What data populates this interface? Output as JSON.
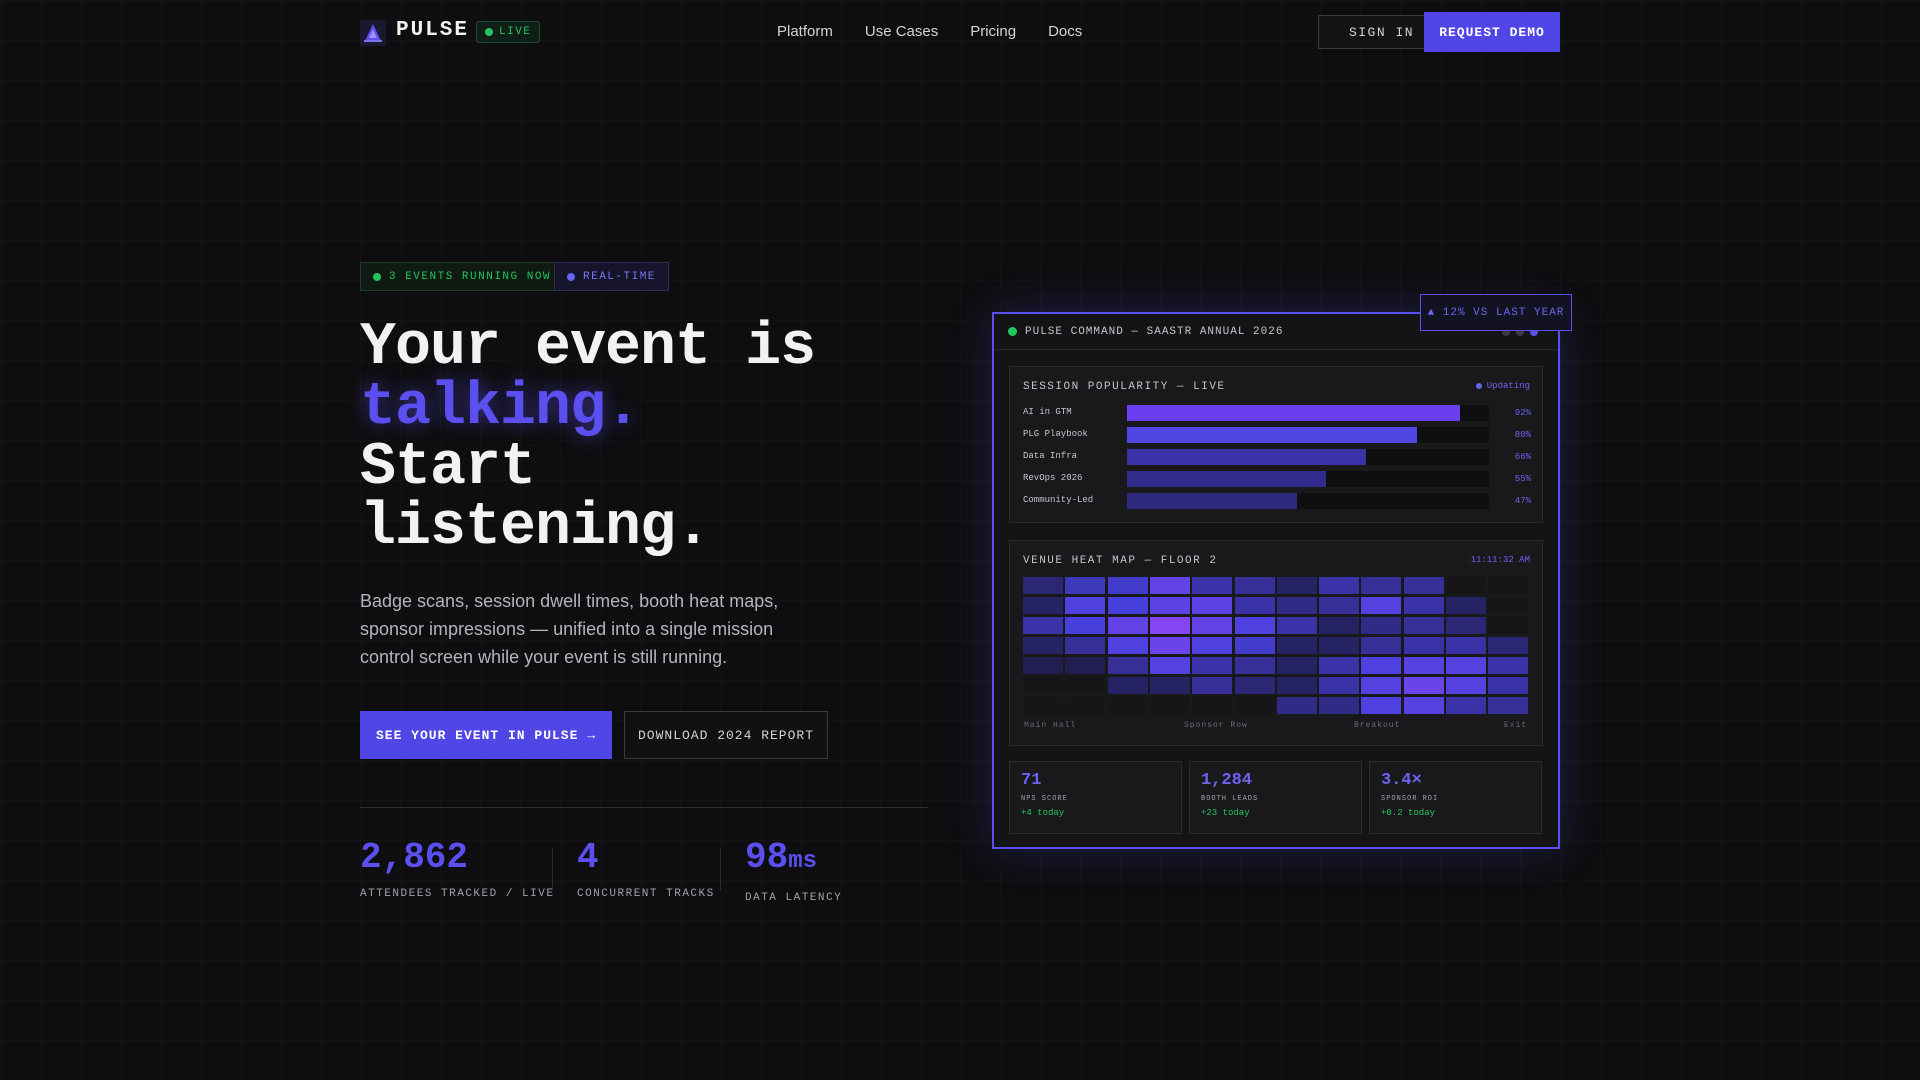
{
  "nav": {
    "brand": "PULSE",
    "live_label": "LIVE",
    "links": [
      "Platform",
      "Use Cases",
      "Pricing",
      "Docs"
    ],
    "sign_in": "SIGN IN",
    "request_demo": "REQUEST DEMO"
  },
  "hero": {
    "chip_events": "3 EVENTS RUNNING NOW",
    "chip_realtime": "REAL-TIME",
    "headline_line1": "Your event is",
    "headline_accent": "talking.",
    "headline_line3": "Start",
    "headline_line4": "listening.",
    "subtitle": "Badge scans, session dwell times, booth heat maps, sponsor impressions — unified into a single mission control screen while your event is still running.",
    "cta_primary": "SEE YOUR EVENT IN PULSE →",
    "cta_secondary": "DOWNLOAD 2024 REPORT",
    "stats": [
      {
        "value": "2,862",
        "unit": "",
        "label": "ATTENDEES TRACKED / LIVE"
      },
      {
        "value": "4",
        "unit": "",
        "label": "CONCURRENT TRACKS"
      },
      {
        "value": "98",
        "unit": "ms",
        "label": "DATA LATENCY"
      }
    ]
  },
  "dashboard": {
    "title": "PULSE COMMAND — SAASTR ANNUAL 2026",
    "yoy_badge": "▲ 12% VS LAST YEAR",
    "session_panel": {
      "title": "SESSION POPULARITY — LIVE",
      "status": "Updating",
      "rows": [
        {
          "label": "AI in GTM",
          "pct": "92%",
          "value": 92,
          "color": "#6b3ff0"
        },
        {
          "label": "PLG Playbook",
          "pct": "80%",
          "value": 80,
          "color": "#5046e4"
        },
        {
          "label": "Data Infra",
          "pct": "66%",
          "value": 66,
          "color": "#3a33a8"
        },
        {
          "label": "RevOps 2026",
          "pct": "55%",
          "value": 55,
          "color": "#312c8c"
        },
        {
          "label": "Community-Led",
          "pct": "47%",
          "value": 47,
          "color": "#2e2a80"
        }
      ]
    },
    "heatmap_panel": {
      "title": "VENUE HEAT MAP — FLOOR 2",
      "time": "11:11:32 AM",
      "zones": [
        "Main Hall",
        "Sponsor Row",
        "Breakout",
        "Exit"
      ],
      "grid": [
        [
          0.2,
          0.4,
          0.45,
          0.7,
          0.35,
          0.3,
          0.15,
          0.35,
          0.3,
          0.3,
          0.05,
          0.05
        ],
        [
          0.15,
          0.55,
          0.5,
          0.65,
          0.65,
          0.35,
          0.25,
          0.3,
          0.6,
          0.35,
          0.15,
          0.05
        ],
        [
          0.35,
          0.5,
          0.7,
          0.95,
          0.7,
          0.55,
          0.35,
          0.15,
          0.25,
          0.3,
          0.2,
          0.05
        ],
        [
          0.15,
          0.3,
          0.55,
          0.75,
          0.55,
          0.45,
          0.15,
          0.15,
          0.3,
          0.35,
          0.35,
          0.2
        ],
        [
          0.1,
          0.1,
          0.3,
          0.6,
          0.35,
          0.3,
          0.15,
          0.35,
          0.55,
          0.6,
          0.6,
          0.35
        ],
        [
          0.05,
          0.05,
          0.15,
          0.15,
          0.3,
          0.2,
          0.15,
          0.35,
          0.6,
          0.75,
          0.6,
          0.35
        ],
        [
          0.03,
          0.03,
          0.05,
          0.05,
          0.05,
          0.05,
          0.25,
          0.25,
          0.55,
          0.6,
          0.35,
          0.3
        ]
      ]
    },
    "cards": [
      {
        "value": "71",
        "label": "NPS SCORE",
        "change": "+4 today"
      },
      {
        "value": "1,284",
        "label": "BOOTH LEADS",
        "change": "+23 today"
      },
      {
        "value": "3.4×",
        "label": "SPONSOR ROI",
        "change": "+0.2 today"
      }
    ]
  }
}
